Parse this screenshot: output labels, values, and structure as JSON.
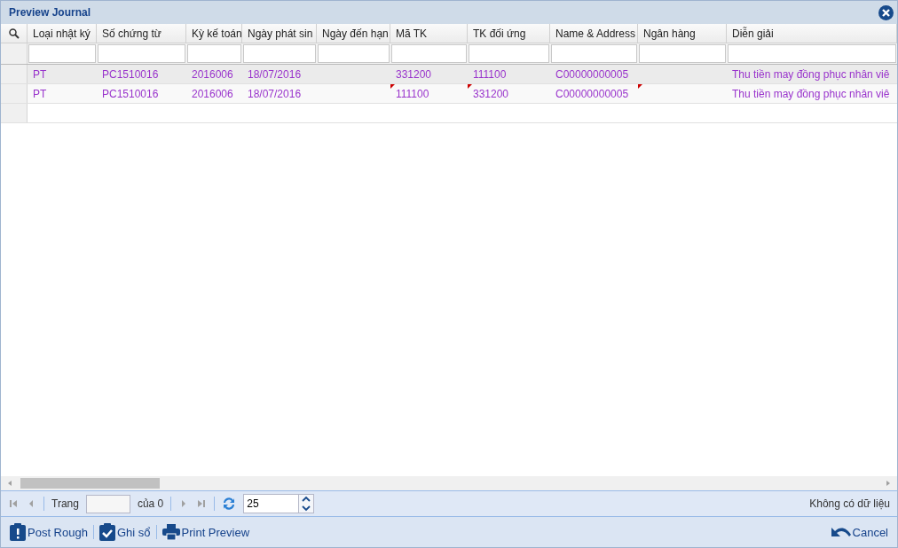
{
  "window": {
    "title": "Preview Journal"
  },
  "table": {
    "columns": [
      "Loại nhật ký",
      "Số chứng từ",
      "Kỳ kế toán",
      "Ngày phát sin",
      "Ngày đến hạn",
      "Mã TK",
      "TK đối ứng",
      "Name & Address",
      "Ngân hàng",
      "Diễn giải"
    ],
    "rows": [
      {
        "selected": true,
        "cells": [
          {
            "text": "PT",
            "modified": false
          },
          {
            "text": "PC1510016",
            "modified": false
          },
          {
            "text": "2016006",
            "modified": false
          },
          {
            "text": "18/07/2016",
            "modified": false
          },
          {
            "modified": false
          },
          {
            "text": "331200",
            "modified": false
          },
          {
            "text": "111100",
            "modified": false
          },
          {
            "text": "C00000000005",
            "modified": false
          },
          {
            "modified": false
          },
          {
            "text": "Thu tiền may đồng phục nhân viê",
            "modified": false
          }
        ]
      },
      {
        "selected": false,
        "cells": [
          {
            "text": "PT",
            "modified": false
          },
          {
            "text": "PC1510016",
            "modified": false
          },
          {
            "text": "2016006",
            "modified": false
          },
          {
            "text": "18/07/2016",
            "modified": false
          },
          {
            "modified": false
          },
          {
            "text": "111100",
            "modified": true
          },
          {
            "text": "331200",
            "modified": true
          },
          {
            "text": "C00000000005",
            "modified": false
          },
          {
            "modified": true
          },
          {
            "text": "Thu tiền may đồng phục nhân viê",
            "modified": false
          }
        ]
      }
    ]
  },
  "pager": {
    "page_label": "Trang",
    "of_label": "của 0",
    "page_size": "25",
    "status": "Không có dữ liệu"
  },
  "toolbar": {
    "left": [
      {
        "kind": "post",
        "label": "Post Rough"
      },
      {
        "kind": "record",
        "label": "Ghi sổ"
      },
      {
        "kind": "print",
        "label": "Print Preview"
      }
    ],
    "right": [
      {
        "kind": "cancel",
        "label": "Cancel"
      }
    ]
  }
}
